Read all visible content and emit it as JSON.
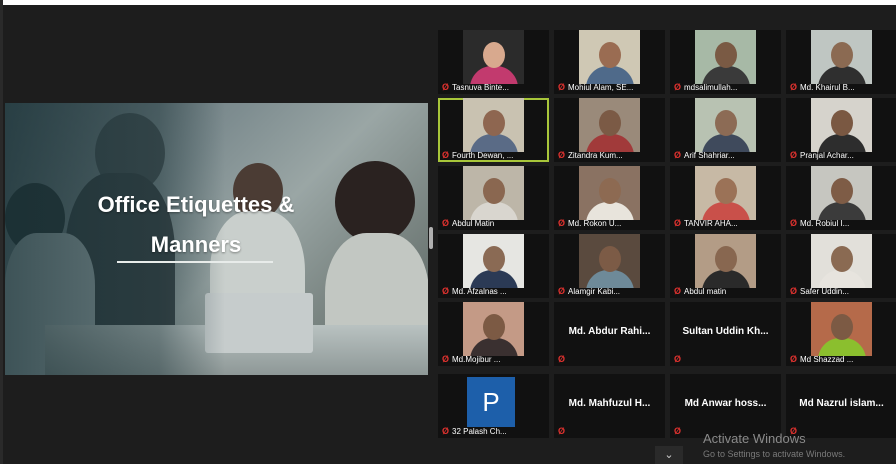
{
  "slide": {
    "title_line1": "Office Etiquettes &",
    "title_line2": "Manners"
  },
  "participants": [
    {
      "name": "Tasnuva Binte...",
      "type": "video",
      "face": "#d8a98e",
      "body": "#c23a6e",
      "bg": "#2b2b2b"
    },
    {
      "name": "Mohiul Alam, SE...",
      "type": "video",
      "face": "#9a6c52",
      "body": "#4f6a8a",
      "bg": "#cfc8b4"
    },
    {
      "name": "mdsalimullah...",
      "type": "video",
      "face": "#7a5a44",
      "body": "#3a3a3a",
      "bg": "#a7b9a6"
    },
    {
      "name": "Md. Khairul B...",
      "type": "video",
      "face": "#8b6a52",
      "body": "#2f2f2f",
      "bg": "#bfc6c2"
    },
    {
      "name": "Fourth Dewan, ...",
      "type": "video",
      "face": "#8e6650",
      "body": "#5a6b86",
      "bg": "#c9c2b1",
      "active": true
    },
    {
      "name": "Zitandra Kum...",
      "type": "video",
      "face": "#7b5a45",
      "body": "#a13a3a",
      "bg": "#9a8a7a"
    },
    {
      "name": "Arif Shahriar...",
      "type": "video",
      "face": "#8c6b55",
      "body": "#3f4a5c",
      "bg": "#b8c2b2"
    },
    {
      "name": "Pranjal Achar...",
      "type": "video",
      "face": "#7a5842",
      "body": "#2d2d2d",
      "bg": "#d6d3cc"
    },
    {
      "name": "Abdul Matin",
      "type": "video",
      "face": "#8a6750",
      "body": "#d9d6cf",
      "bg": "#bdb6a8"
    },
    {
      "name": "Md. Rokon U...",
      "type": "video",
      "face": "#8d6a52",
      "body": "#e8e4dc",
      "bg": "#8a7262"
    },
    {
      "name": "TANVIR AHA...",
      "type": "video",
      "face": "#9b7257",
      "body": "#c9504a",
      "bg": "#c7b9a5"
    },
    {
      "name": "Md. Robiul I...",
      "type": "video",
      "face": "#7e5c46",
      "body": "#3b3b3b",
      "bg": "#c6c6c0"
    },
    {
      "name": "Md. Afzalnas ...",
      "type": "video",
      "face": "#8a6a54",
      "body": "#2b3a55",
      "bg": "#e6e6e2"
    },
    {
      "name": "Alamgir Kabi...",
      "type": "video",
      "face": "#7c5b46",
      "body": "#6e8a99",
      "bg": "#5a4a3e"
    },
    {
      "name": "Abdul matin",
      "type": "video",
      "face": "#886750",
      "body": "#2a2a2a",
      "bg": "#b39c86"
    },
    {
      "name": "Safer Uddin...",
      "type": "video",
      "face": "#8a6a52",
      "body": "#e7e4de",
      "bg": "#e2e0da"
    },
    {
      "name": "Md.Mojibur ...",
      "type": "video",
      "face": "#7c5a44",
      "body": "#3a3030",
      "bg": "#c49a86"
    },
    {
      "name": "Md. Abdur Rahi...",
      "type": "name"
    },
    {
      "name": "Sultan Uddin Kh...",
      "type": "name"
    },
    {
      "name": "Md Shazzad ...",
      "type": "video",
      "face": "#7c5a44",
      "body": "#8bbf2e",
      "bg": "#b56a4a"
    },
    {
      "name": "32 Palash Ch...",
      "type": "avatar",
      "initial": "P"
    },
    {
      "name": "Md. Mahfuzul H...",
      "type": "name"
    },
    {
      "name": "Md Anwar hoss...",
      "type": "name"
    },
    {
      "name": "Md Nazrul islam...",
      "type": "name"
    }
  ],
  "watermark": {
    "line1": "Activate Windows",
    "line2": "Go to Settings to activate Windows."
  },
  "colors": {
    "active_speaker": "#a8c63a",
    "muted_mic": "#e0322f",
    "avatar_bg": "#1d5faa"
  }
}
